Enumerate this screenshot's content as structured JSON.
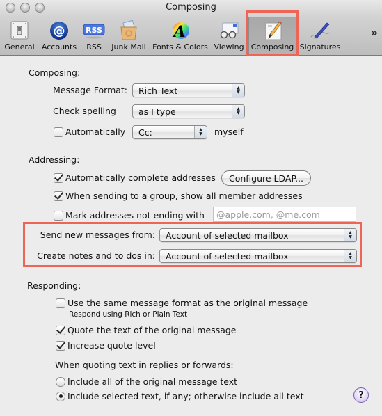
{
  "window": {
    "title": "Composing"
  },
  "toolbar": {
    "items": [
      {
        "label": "General",
        "icon": "general-switch-icon"
      },
      {
        "label": "Accounts",
        "icon": "at-sign-icon"
      },
      {
        "label": "RSS",
        "icon": "rss-icon"
      },
      {
        "label": "Junk Mail",
        "icon": "junk-mail-icon"
      },
      {
        "label": "Fonts & Colors",
        "icon": "fonts-colors-icon"
      },
      {
        "label": "Viewing",
        "icon": "viewing-glasses-icon"
      },
      {
        "label": "Composing",
        "icon": "pencil-paper-icon",
        "selected": true
      },
      {
        "label": "Signatures",
        "icon": "pen-signature-icon"
      }
    ],
    "overflow": "»",
    "rss_badge": "RSS",
    "at_glyph": "@",
    "fonts_glyph": "A"
  },
  "composing": {
    "title": "Composing:",
    "message_format_label": "Message Format:",
    "message_format_value": "Rich Text",
    "check_spelling_label": "Check spelling",
    "check_spelling_value": "as I type",
    "automatically_label": "Automatically",
    "automatically_checked": false,
    "cc_value": "Cc:",
    "myself_label": "myself"
  },
  "addressing": {
    "title": "Addressing:",
    "auto_complete_label": "Automatically complete addresses",
    "auto_complete_checked": true,
    "configure_ldap_label": "Configure LDAP...",
    "show_group_label": "When sending to a group, show all member addresses",
    "show_group_checked": true,
    "mark_addresses_label": "Mark addresses not ending with",
    "mark_addresses_checked": false,
    "mark_addresses_placeholder": "@apple.com, @me.com",
    "send_from_label": "Send new messages from:",
    "send_from_value": "Account of selected mailbox",
    "notes_label": "Create notes and to dos in:",
    "notes_value": "Account of selected mailbox"
  },
  "responding": {
    "title": "Responding:",
    "same_format_label": "Use the same message format as the original message",
    "same_format_checked": false,
    "same_format_note": "Respond using Rich or Plain Text",
    "quote_text_label": "Quote the text of the original message",
    "quote_text_checked": true,
    "increase_quote_label": "Increase quote level",
    "increase_quote_checked": true,
    "quoting_header": "When quoting text in replies or forwards:",
    "radio_all_label": "Include all of the original message text",
    "radio_selected_label": "Include selected text, if any; otherwise include all text",
    "selected_radio": "selected"
  },
  "help": {
    "glyph": "?"
  },
  "colors": {
    "highlight": "#ee6455",
    "background": "#ececec"
  }
}
